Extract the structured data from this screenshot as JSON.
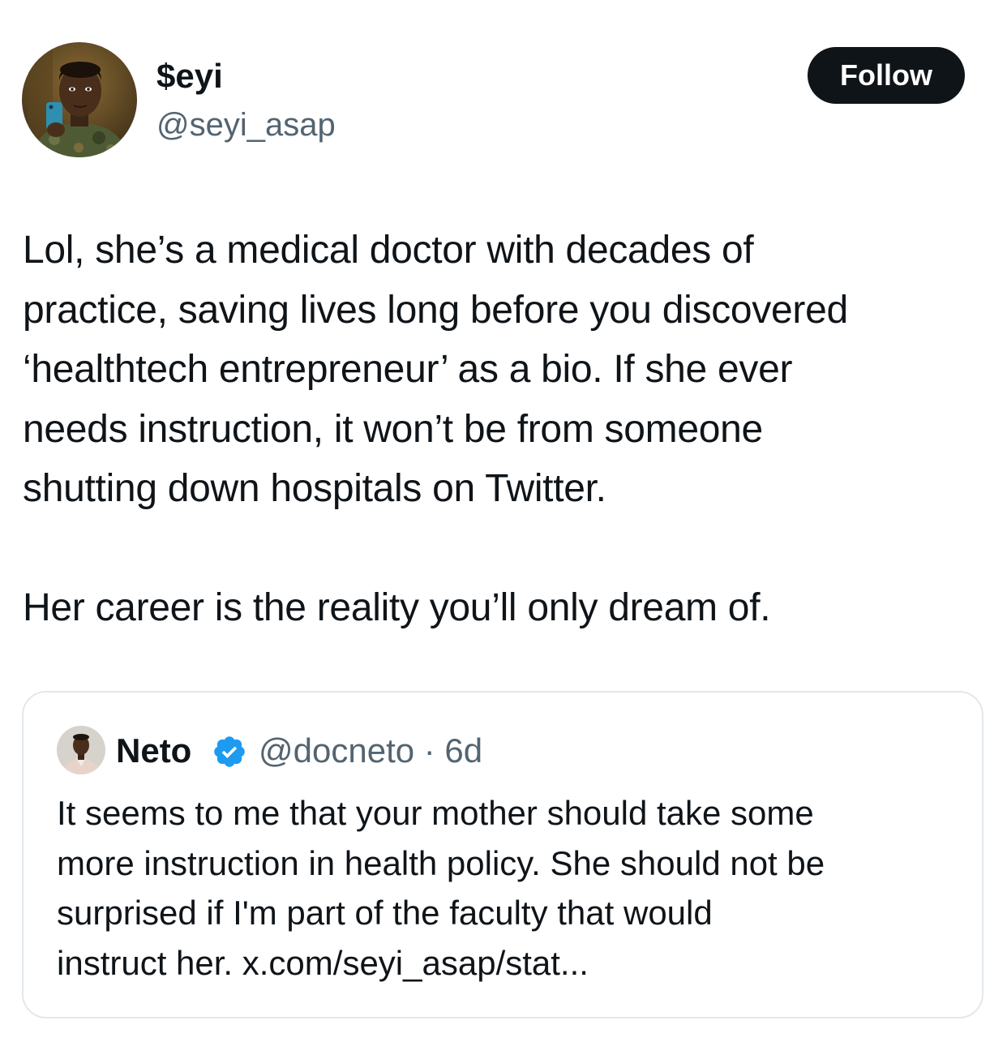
{
  "author": {
    "display_name": "$eyi",
    "handle": "@seyi_asap",
    "avatar_icon": "profile-photo"
  },
  "follow_button": {
    "label": "Follow"
  },
  "tweet": {
    "lines_paragraph_1": [
      "Lol, she’s a medical doctor with decades of",
      "practice, saving lives long before you discovered",
      "‘healthtech entrepreneur’ as a bio. If she ever",
      "needs instruction, it won’t be from someone",
      "shutting down hospitals on Twitter."
    ],
    "lines_paragraph_2": [
      "Her career is the reality you’ll only dream of."
    ]
  },
  "quoted_tweet": {
    "display_name": "Neto",
    "verified_icon": "verified-badge",
    "verified_color": "#1d9bf0",
    "handle_and_time": "@docneto · 6d",
    "lines": [
      "It seems to me that your mother should take some",
      "more instruction in health policy. She should not be",
      "surprised if I'm part of the faculty that would",
      "instruct her. x.com/seyi_asap/stat..."
    ]
  },
  "colors": {
    "text_primary": "#0f1419",
    "text_secondary": "#536471",
    "button_bg": "#0f1419",
    "card_border": "#e1e8ed"
  }
}
